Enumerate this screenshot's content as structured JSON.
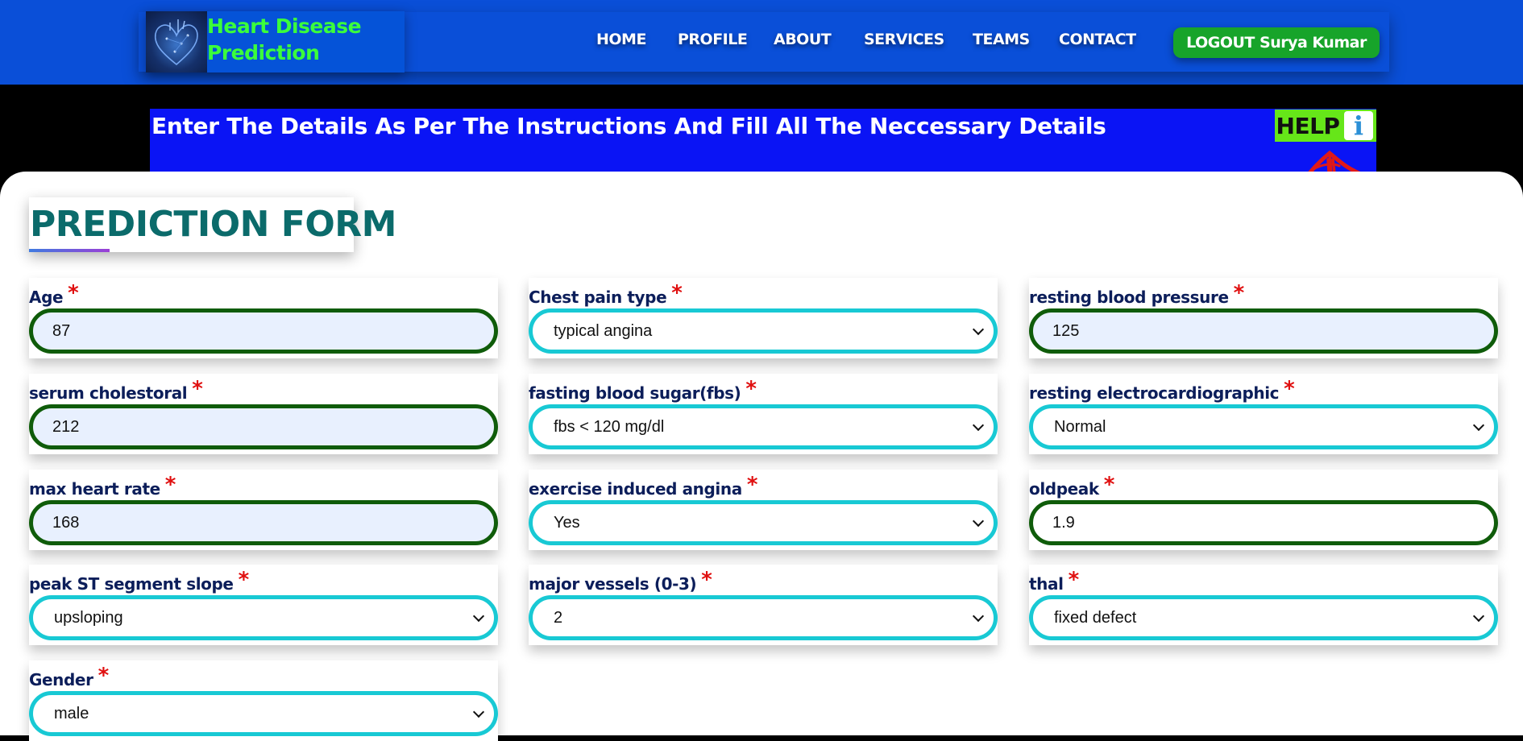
{
  "header": {
    "brand": "Heart Disease Prediction",
    "nav": [
      "HOME",
      "PROFILE",
      "ABOUT",
      "SERVICES",
      "TEAMS",
      "CONTACT"
    ],
    "logout_label": "LOGOUT Surya Kumar"
  },
  "banner": {
    "instructions": "Enter The Details As Per The Instructions And Fill All The Neccessary Details",
    "help_label": "HELP",
    "help_icon": "info-icon"
  },
  "form": {
    "title": "PREDICTION FORM",
    "required_mark": "*",
    "fields": {
      "age": {
        "label": "Age",
        "value": "87"
      },
      "chest_pain": {
        "label": "Chest pain type",
        "value": "typical angina"
      },
      "resting_bp": {
        "label": "resting blood pressure",
        "value": "125"
      },
      "cholesterol": {
        "label": "serum cholestoral",
        "value": "212"
      },
      "fbs": {
        "label": "fasting blood sugar(fbs)",
        "value": "fbs < 120 mg/dl"
      },
      "restecg": {
        "label": "resting electrocardiographic",
        "value": "Normal"
      },
      "max_hr": {
        "label": "max heart rate",
        "value": "168"
      },
      "exang": {
        "label": "exercise induced angina",
        "value": "Yes"
      },
      "oldpeak": {
        "label": "oldpeak",
        "value": "1.9"
      },
      "slope": {
        "label": "peak ST segment slope",
        "value": "upsloping"
      },
      "vessels": {
        "label": "major vessels (0-3)",
        "value": "2"
      },
      "thal": {
        "label": "thal",
        "value": "fixed defect"
      },
      "gender": {
        "label": "Gender",
        "value": "male"
      }
    }
  },
  "colors": {
    "header_blue": "#0a4fd8",
    "banner_blue": "#0a14f5",
    "brand_green": "#3bff3b",
    "logout_green": "#17a42a",
    "help_green": "#66e619",
    "title_teal": "#0b6b6b",
    "input_border": "#0f5c0a",
    "select_border": "#18c9d4",
    "required_red": "#e01010"
  }
}
